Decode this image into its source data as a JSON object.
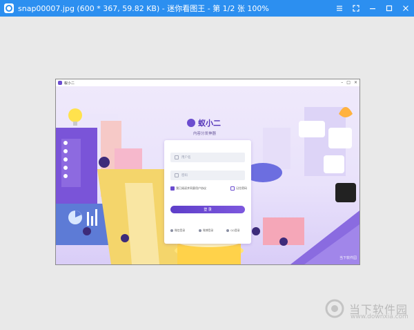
{
  "viewer": {
    "title": "snap00007.jpg (600 * 367, 59.82 KB) - 迷你看图王 - 第 1/2 张 100%",
    "controls": [
      "menu-icon",
      "fullscreen-icon",
      "minimize-icon",
      "maximize-icon",
      "close-icon"
    ],
    "accent": "#2c8ff0"
  },
  "app": {
    "window_title": "蚁小二",
    "brand_name": "蚁小二",
    "tagline": "内容分发神器",
    "username_placeholder": "用户名",
    "password_placeholder": "密码",
    "agree_label": "我已阅读并同意用户协议",
    "remember_label": "记住密码",
    "login_label": "登 录",
    "social": [
      {
        "label": "微信登录"
      },
      {
        "label": "微博登录"
      },
      {
        "label": "QQ登录"
      }
    ],
    "watermark": "当下软件园",
    "accent": "#6b4ccf"
  },
  "site_watermark": {
    "text": "当下软件园",
    "url": "www.downxia.com"
  }
}
